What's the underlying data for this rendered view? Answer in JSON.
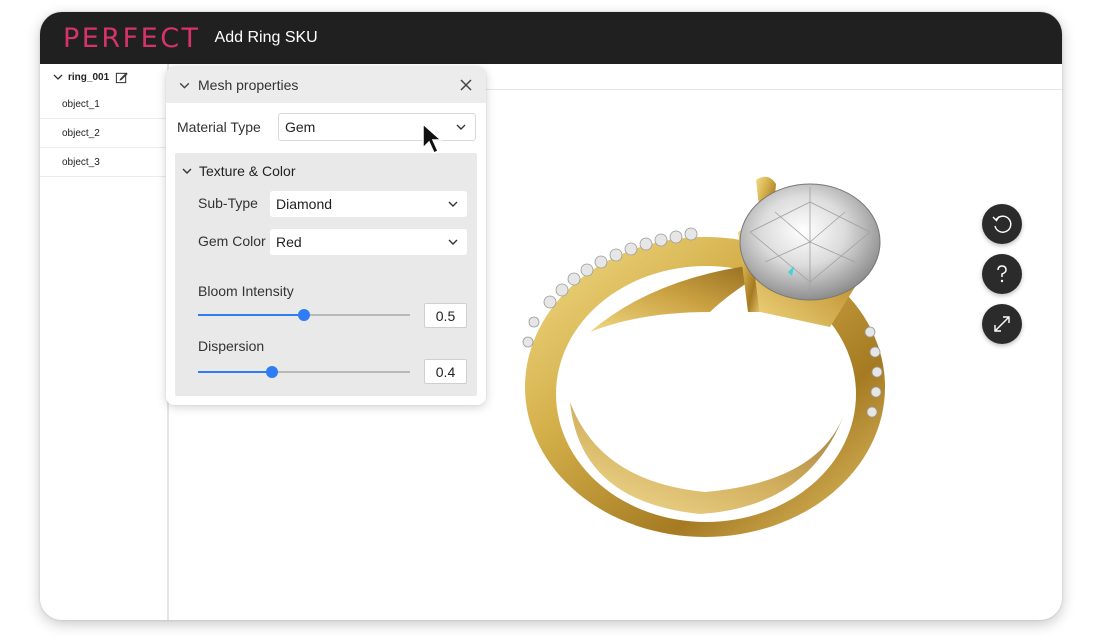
{
  "app": {
    "brand": "PERFECT",
    "title": "Add Ring SKU"
  },
  "sidebar": {
    "root": "ring_001",
    "items": [
      {
        "label": "object_1"
      },
      {
        "label": "object_2"
      },
      {
        "label": "object_3"
      }
    ]
  },
  "panel": {
    "title": "Mesh properties",
    "material_type": {
      "label": "Material Type",
      "value": "Gem"
    },
    "section": {
      "title": "Texture & Color",
      "sub_type": {
        "label": "Sub-Type",
        "value": "Diamond"
      },
      "gem_color": {
        "label": "Gem Color",
        "value": "Red"
      },
      "bloom": {
        "label": "Bloom Intensity",
        "value": "0.5",
        "fraction": 0.5
      },
      "dispersion": {
        "label": "Dispersion",
        "value": "0.4",
        "fraction": 0.35
      }
    }
  },
  "viewer_controls": [
    {
      "icon": "rotate-reset-icon"
    },
    {
      "icon": "help-icon"
    },
    {
      "icon": "expand-icon"
    }
  ],
  "colors": {
    "brand": "#d6336c",
    "accent": "#2f7cf6",
    "titlebar": "#202020",
    "gold": "#d4b04a"
  }
}
